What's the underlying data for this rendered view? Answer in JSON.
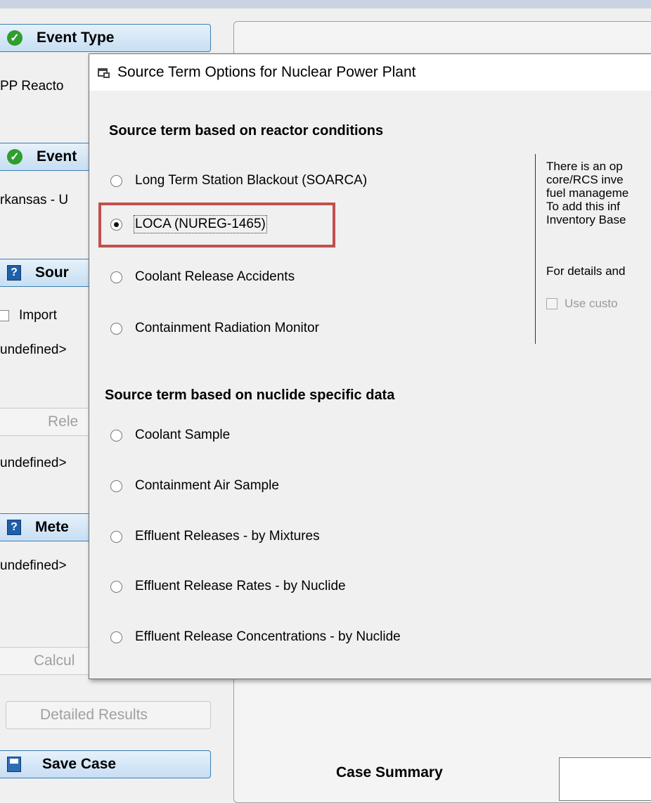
{
  "sidebar": {
    "event_type": {
      "label": "Event Type",
      "value": "PP Reacto"
    },
    "event": {
      "label": "Event",
      "value": "rkansas - U"
    },
    "source": {
      "label": "Sour",
      "import_label": "Import",
      "value": "undefined>"
    },
    "release": {
      "label": "Rele",
      "value": "undefined>"
    },
    "meteorology": {
      "label": "Mete",
      "value": "undefined>"
    },
    "calculate": {
      "label": "Calcul"
    },
    "detailed_results": {
      "label": "Detailed Results"
    },
    "save_case": {
      "label": "Save Case"
    }
  },
  "main": {
    "case_summary_label": "Case Summary"
  },
  "dialog": {
    "title": "Source Term Options for Nuclear Power Plant",
    "reactor_section": {
      "heading": "Source term based on reactor conditions",
      "options": [
        "Long Term Station Blackout (SOARCA)",
        "LOCA (NUREG-1465)",
        "Coolant Release Accidents",
        "Containment Radiation Monitor"
      ],
      "selected": "LOCA (NUREG-1465)"
    },
    "nuclide_section": {
      "heading": "Source term based on nuclide specific data",
      "options": [
        "Coolant Sample",
        "Containment Air Sample",
        "Effluent Releases - by Mixtures",
        "Effluent Release Rates - by Nuclide",
        "Effluent Release Concentrations - by Nuclide"
      ]
    },
    "info": {
      "lines": [
        "There is an op",
        "core/RCS inve",
        "fuel manageme",
        "To add this inf",
        "Inventory Base"
      ],
      "details": "For details and",
      "custom_checkbox_label": "Use custo"
    }
  },
  "colors": {
    "highlight": "#c0504d",
    "check_icon": "#2e9e2e",
    "help_icon": "#1f5fa8"
  }
}
